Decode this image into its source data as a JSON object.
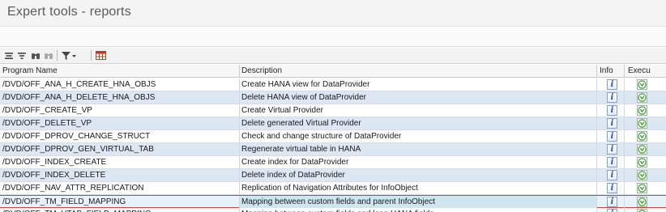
{
  "window": {
    "title": "Expert tools - reports"
  },
  "toolbar": {
    "icons": [
      "sort-ascending-icon",
      "sort-descending-icon",
      "find-icon",
      "find-next-icon",
      "filter-icon",
      "layout-grid-icon"
    ]
  },
  "table": {
    "headers": {
      "program": "Program Name",
      "description": "Description",
      "info": "Info",
      "execute": "Execu"
    },
    "info_symbol": "i",
    "rows": [
      {
        "program": "/DVD/OFF_ANA_H_CREATE_HNA_OBJS",
        "description": "Create HANA view for DataProvider"
      },
      {
        "program": "/DVD/OFF_ANA_H_DELETE_HNA_OBJS",
        "description": "Delete HANA view of DataProvider"
      },
      {
        "program": "/DVD/OFF_CREATE_VP",
        "description": "Create Virtual Provider"
      },
      {
        "program": "/DVD/OFF_DELETE_VP",
        "description": "Delete generated Virtual Provider"
      },
      {
        "program": "/DVD/OFF_DPROV_CHANGE_STRUCT",
        "description": "Check and change structure of DataProvider"
      },
      {
        "program": "/DVD/OFF_DPROV_GEN_VIRTUAL_TAB",
        "description": "Regenerate virtual table in HANA"
      },
      {
        "program": "/DVD/OFF_INDEX_CREATE",
        "description": "Create index for DataProvider"
      },
      {
        "program": "/DVD/OFF_INDEX_DELETE",
        "description": "Delete index of DataProvider"
      },
      {
        "program": "/DVD/OFF_NAV_ATTR_REPLICATION",
        "description": "Replication of Navigation Attributes for InfoObject"
      },
      {
        "program": "/DVD/OFF_TM_FIELD_MAPPING",
        "description": "Mapping between custom fields and parent InfoObject"
      },
      {
        "program": "/DVD/OFF_TM_HTAB_FIELD_MAPPING",
        "description": "Mapping between custom fields and long HANA fields"
      }
    ]
  },
  "colors": {
    "row_alt": "#dde6f3",
    "selected_border": "#cc4444",
    "info_blue": "#2255aa",
    "exec_green": "#3a9a3a"
  }
}
